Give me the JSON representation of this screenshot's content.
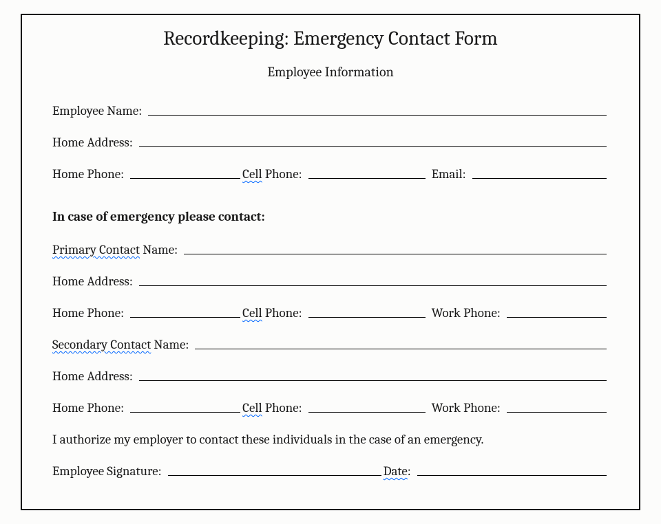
{
  "title": "Recordkeeping:  Emergency Contact Form",
  "subtitle": "Employee Information",
  "employee_name_label": "Employee Name:",
  "home_address_label": "Home Address:",
  "home_phone_label": "Home Phone:",
  "cell_squiggle": "Cell",
  "cell_rest": " Phone:",
  "email_label": "Email:",
  "section_heading": "In case of emergency please contact:",
  "primary_squiggle": "Primary  Contact",
  "primary_rest": " Name:",
  "work_phone_label": "Work Phone:",
  "secondary_squiggle": "Secondary  Contact",
  "secondary_rest": " Name:",
  "auth_text": "I authorize my employer to contact these individuals in the case of an emergency.",
  "sig_label": "Employee Signature:",
  "date_squiggle": "Date",
  "date_rest": ":"
}
